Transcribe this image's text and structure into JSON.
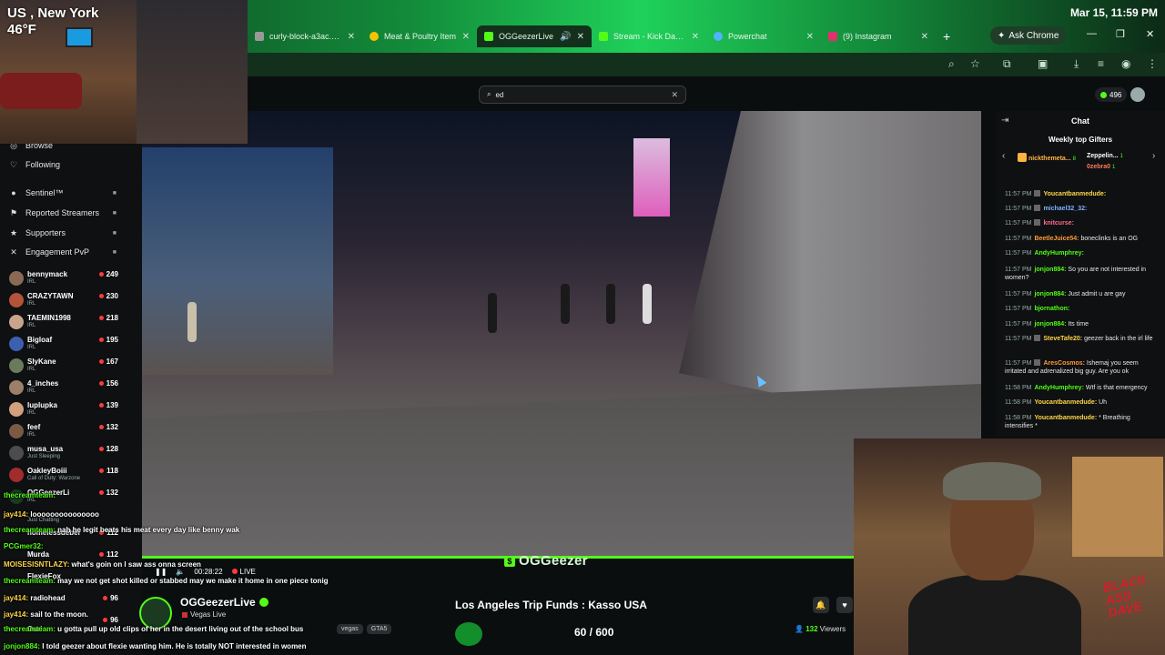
{
  "os": {
    "datetime": "Mar 15, 11:59 PM"
  },
  "browser": {
    "tabs": [
      {
        "title": "curly-block-a3ac.bla",
        "color": "#999999"
      },
      {
        "title": "Meat & Poultry Item",
        "color": "#f5c400"
      },
      {
        "title": "OGGeezerLive",
        "color": "#53fc18"
      },
      {
        "title": "Stream - Kick Dashb",
        "color": "#53fc18"
      },
      {
        "title": "Powerchat",
        "color": "#4fb3ff"
      },
      {
        "title": "(9) Instagram",
        "color": "#e1306c"
      }
    ],
    "new_tab": "+",
    "ask_chrome": "Ask Chrome",
    "win_min": "—",
    "win_max": "❐",
    "win_close": "✕"
  },
  "kick": {
    "search_value": "ed",
    "coins": "496",
    "accent": "#53fc18"
  },
  "sidebar": {
    "nav": [
      {
        "label": "Browse",
        "icon": "compass-icon"
      },
      {
        "label": "Following",
        "icon": "heart-icon"
      },
      {
        "label": "Sentinel™",
        "icon": "dot-icon"
      },
      {
        "label": "Reported Streamers",
        "icon": "flag-icon"
      },
      {
        "label": "Supporters",
        "icon": "star-icon"
      },
      {
        "label": "Engagement PvP",
        "icon": "swords-icon"
      }
    ],
    "channels": [
      {
        "name": "bennymack",
        "cat": "IRL",
        "viewers": "249"
      },
      {
        "name": "CRAZYTAWN",
        "cat": "IRL",
        "viewers": "230"
      },
      {
        "name": "TAEMIN1998",
        "cat": "IRL",
        "viewers": "218"
      },
      {
        "name": "Bigloaf",
        "cat": "IRL",
        "viewers": "195"
      },
      {
        "name": "SlyKane",
        "cat": "IRL",
        "viewers": "167"
      },
      {
        "name": "4_inches",
        "cat": "IRL",
        "viewers": "156"
      },
      {
        "name": "luplupka",
        "cat": "IRL",
        "viewers": "139"
      },
      {
        "name": "feef",
        "cat": "IRL",
        "viewers": "132"
      },
      {
        "name": "musa_usa",
        "cat": "Just Sleeping",
        "viewers": "128"
      },
      {
        "name": "OakleyBoiii",
        "cat": "Call of Duty: Warzone",
        "viewers": "118"
      },
      {
        "name": "OGGeezerLi",
        "cat": "IRL",
        "viewers": "132"
      },
      {
        "name": "",
        "cat": "Just Chatting",
        "viewers": ""
      },
      {
        "name": "homelessdeber",
        "cat": "",
        "viewers": "112"
      },
      {
        "name": "Murda",
        "cat": "",
        "viewers": "112"
      },
      {
        "name": "FlexieFox",
        "cat": "",
        "viewers": ""
      },
      {
        "name": "",
        "cat": "",
        "viewers": "96"
      },
      {
        "name": "",
        "cat": "",
        "viewers": "96"
      },
      {
        "name": "Ouri",
        "cat": "",
        "viewers": ""
      }
    ]
  },
  "player": {
    "time": "00:28:22",
    "live": "LIVE",
    "watermark": "OGGeezer"
  },
  "stream": {
    "name": "OGGeezerLive",
    "category": "Vegas Live",
    "tags": [
      "vegas",
      "GTA5"
    ],
    "fund_title": "Los Angeles Trip Funds : Kasso USA",
    "fund_count": "60 / 600",
    "viewers": "132",
    "viewers_label": "Viewers"
  },
  "chat": {
    "title": "Chat",
    "gifters_title": "Weekly top Gifters",
    "gifters": [
      {
        "name": "nickthemeta...",
        "count": "8",
        "color": "#ffb340"
      },
      {
        "name": "Zeppelin...",
        "count": "1",
        "color": "#ffffff"
      },
      {
        "name": "0zebra0",
        "count": "1",
        "color": "#ff7a5a"
      }
    ],
    "messages": [
      {
        "time": "11:57 PM",
        "user": "Youcantbanmedude:",
        "color": "#ffd54a",
        "text": ""
      },
      {
        "time": "11:57 PM",
        "user": "michael32_32:",
        "color": "#7fb0ff",
        "text": ""
      },
      {
        "time": "11:57 PM",
        "user": "knitcurse:",
        "color": "#ff6a8a",
        "text": ""
      },
      {
        "time": "11:57 PM",
        "user": "BeetleJuice54:",
        "color": "#ff9a3a",
        "text": "boneclinks is an OG"
      },
      {
        "time": "11:57 PM",
        "user": "AndyHumphrey:",
        "color": "#53fc18",
        "text": ""
      },
      {
        "time": "11:57 PM",
        "user": "jonjon884:",
        "color": "#53fc18",
        "text": "So you are not interested in women?"
      },
      {
        "time": "11:57 PM",
        "user": "jonjon884:",
        "color": "#53fc18",
        "text": "Just admit u are gay"
      },
      {
        "time": "11:57 PM",
        "user": "bjornathon:",
        "color": "#53fc18",
        "text": ""
      },
      {
        "time": "11:57 PM",
        "user": "jonjon884:",
        "color": "#53fc18",
        "text": "Its time"
      },
      {
        "time": "11:57 PM",
        "user": "SteveTafe20:",
        "color": "#ffd54a",
        "text": "geezer back in the irl life"
      },
      {
        "time": "11:57 PM",
        "user": "AresCosmos:",
        "color": "#ff9a3a",
        "text": "Ishemaj you seem irritated and adrenalized big guy. Are you ok"
      },
      {
        "time": "11:58 PM",
        "user": "AndyHumphrey:",
        "color": "#53fc18",
        "text": "Wtf is that emergency"
      },
      {
        "time": "11:58 PM",
        "user": "Youcantbanmedude:",
        "color": "#ffd54a",
        "text": "Uh"
      },
      {
        "time": "11:58 PM",
        "user": "Youcantbanmedude:",
        "color": "#ffd54a",
        "text": "* Breathing intensifies *"
      }
    ]
  },
  "overlay": {
    "weather_loc": "US , New York",
    "weather_temp": "46°F",
    "stamp": "BLACK ASS DAVE",
    "chat": [
      {
        "user": "thecreamteam:",
        "text": "",
        "cls": "u"
      },
      {
        "user": "jay414:",
        "text": "looooooooooooooo",
        "cls": "u y"
      },
      {
        "user": "thecreamteam:",
        "text": "nah he legit beats his meat every day like benny wak",
        "cls": "u"
      },
      {
        "user": "PCGmer32:",
        "text": "",
        "cls": "u"
      },
      {
        "user": "MOISESISNTLAZY:",
        "text": "what's goin on I saw ass onna screen",
        "cls": "u y"
      },
      {
        "user": "thecreamteam:",
        "text": "may we not get shot killed or stabbed may we make it home in one piece tonig",
        "cls": "u"
      },
      {
        "user": "jay414:",
        "text": "radiohead",
        "cls": "u y"
      },
      {
        "user": "jay414:",
        "text": "sail to the moon.",
        "cls": "u y"
      },
      {
        "user": "thecreamteam:",
        "text": "u gotta pull up old clips of her in the desert living out of the school bus",
        "cls": "u"
      },
      {
        "user": "jonjon884:",
        "text": "I told geezer about flexie wanting him. He is totally NOT interested in women",
        "cls": "u"
      }
    ]
  }
}
